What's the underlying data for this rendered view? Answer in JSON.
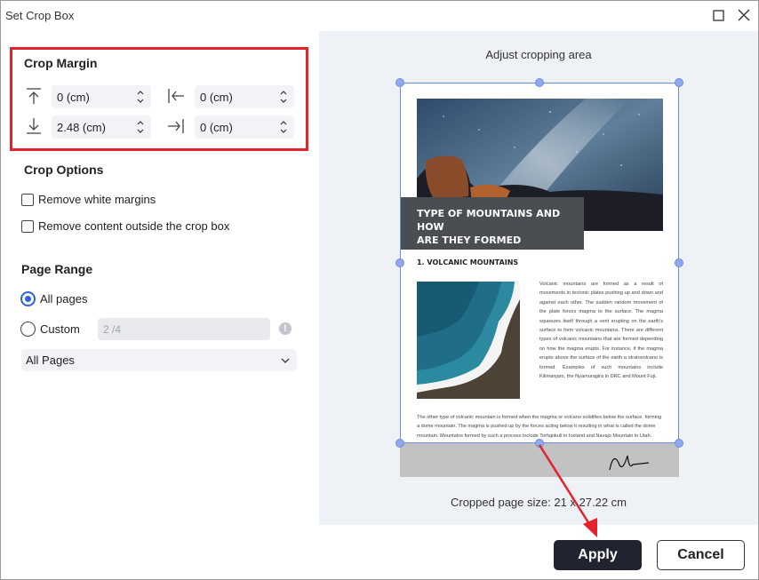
{
  "window": {
    "title": "Set Crop Box"
  },
  "crop_margin": {
    "title": "Crop Margin",
    "top": "0 (cm)",
    "left": "0 (cm)",
    "bottom": "2.48 (cm)",
    "right": "0 (cm)"
  },
  "crop_options": {
    "title": "Crop Options",
    "remove_white_margins": {
      "label": "Remove white margins",
      "checked": false
    },
    "remove_outside": {
      "label": "Remove content outside the crop box",
      "checked": false
    }
  },
  "page_range": {
    "title": "Page Range",
    "all_pages_label": "All pages",
    "custom_label": "Custom",
    "custom_placeholder": "2 /4",
    "info_glyph": "!",
    "selected": "all",
    "dropdown_value": "All Pages"
  },
  "preview": {
    "title": "Adjust cropping area",
    "headline_line1": "TYPE OF MOUNTAINS AND HOW",
    "headline_line2": "ARE THEY FORMED",
    "subhead": "1. VOLCANIC MOUNTAINS",
    "body_right": "Volcanic mountains are formed as a result of movements in tectonic plates pushing up and down and against each other. The sudden random movement of the plate forces magma to the surface. The magma squeezes itself through a vent erupting on the earth's surface to form volcanic mountains. There are different types of volcanic mountains that are formed depending on how the magma erupts. For instance, if the magma erupts above the surface of the earth a stratovolcano is formed. Examples of such mountains include Kilimanjaro, the Nyamuragira in DRC and Mount Fuji.",
    "body_bottom": "The other type of volcanic mountain is formed when the magma or volcano solidifies below the surface. forming a dome mountain. The magma is pushed up by the forces acting below it resulting in what is called the dome mountain. Mountains formed by such a process include Torfajokull in Iceland and Navajo Mountain in Utah.",
    "cropped_size": "Cropped page size: 21 x 27.22 cm"
  },
  "buttons": {
    "apply": "Apply",
    "cancel": "Cancel"
  },
  "colors": {
    "highlight": "#e3222b",
    "accent": "#2b63d9",
    "apply_bg": "#212430",
    "preview_bg": "#eef1f6"
  },
  "icons": [
    "maximize-icon",
    "close-icon",
    "margin-top-icon",
    "margin-left-icon",
    "margin-bottom-icon",
    "margin-right-icon",
    "chevron-up-down-icon",
    "chevron-down-icon",
    "info-icon",
    "signature-icon"
  ]
}
